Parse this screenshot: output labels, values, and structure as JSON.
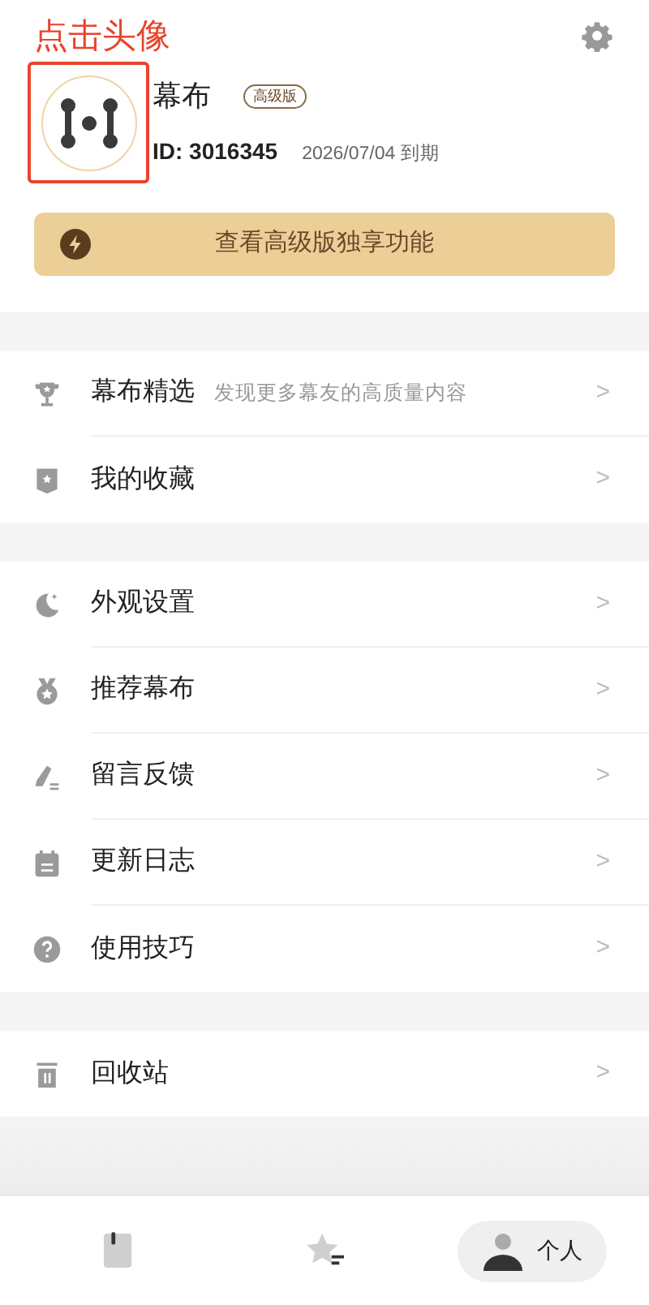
{
  "annotation": {
    "text": "点击头像"
  },
  "profile": {
    "name": "幕布",
    "badge": "高级版",
    "id": "ID: 3016345",
    "expiry": "2026/07/04 到期"
  },
  "premium_button": {
    "label": "查看高级版独享功能"
  },
  "menu_groups": [
    [
      {
        "label": "幕布精选",
        "subtitle": "发现更多幕友的高质量内容",
        "chevron": ">"
      },
      {
        "label": "我的收藏",
        "chevron": ">"
      }
    ],
    [
      {
        "label": "外观设置",
        "chevron": ">"
      },
      {
        "label": "推荐幕布",
        "chevron": ">"
      },
      {
        "label": "留言反馈",
        "chevron": ">"
      },
      {
        "label": "更新日志",
        "chevron": ">"
      },
      {
        "label": "使用技巧",
        "chevron": ">"
      }
    ],
    [
      {
        "label": "回收站",
        "chevron": ">"
      }
    ]
  ],
  "tab_bar": [
    {
      "selected": false
    },
    {
      "selected": false
    },
    {
      "label": "个人",
      "selected": true
    }
  ]
}
